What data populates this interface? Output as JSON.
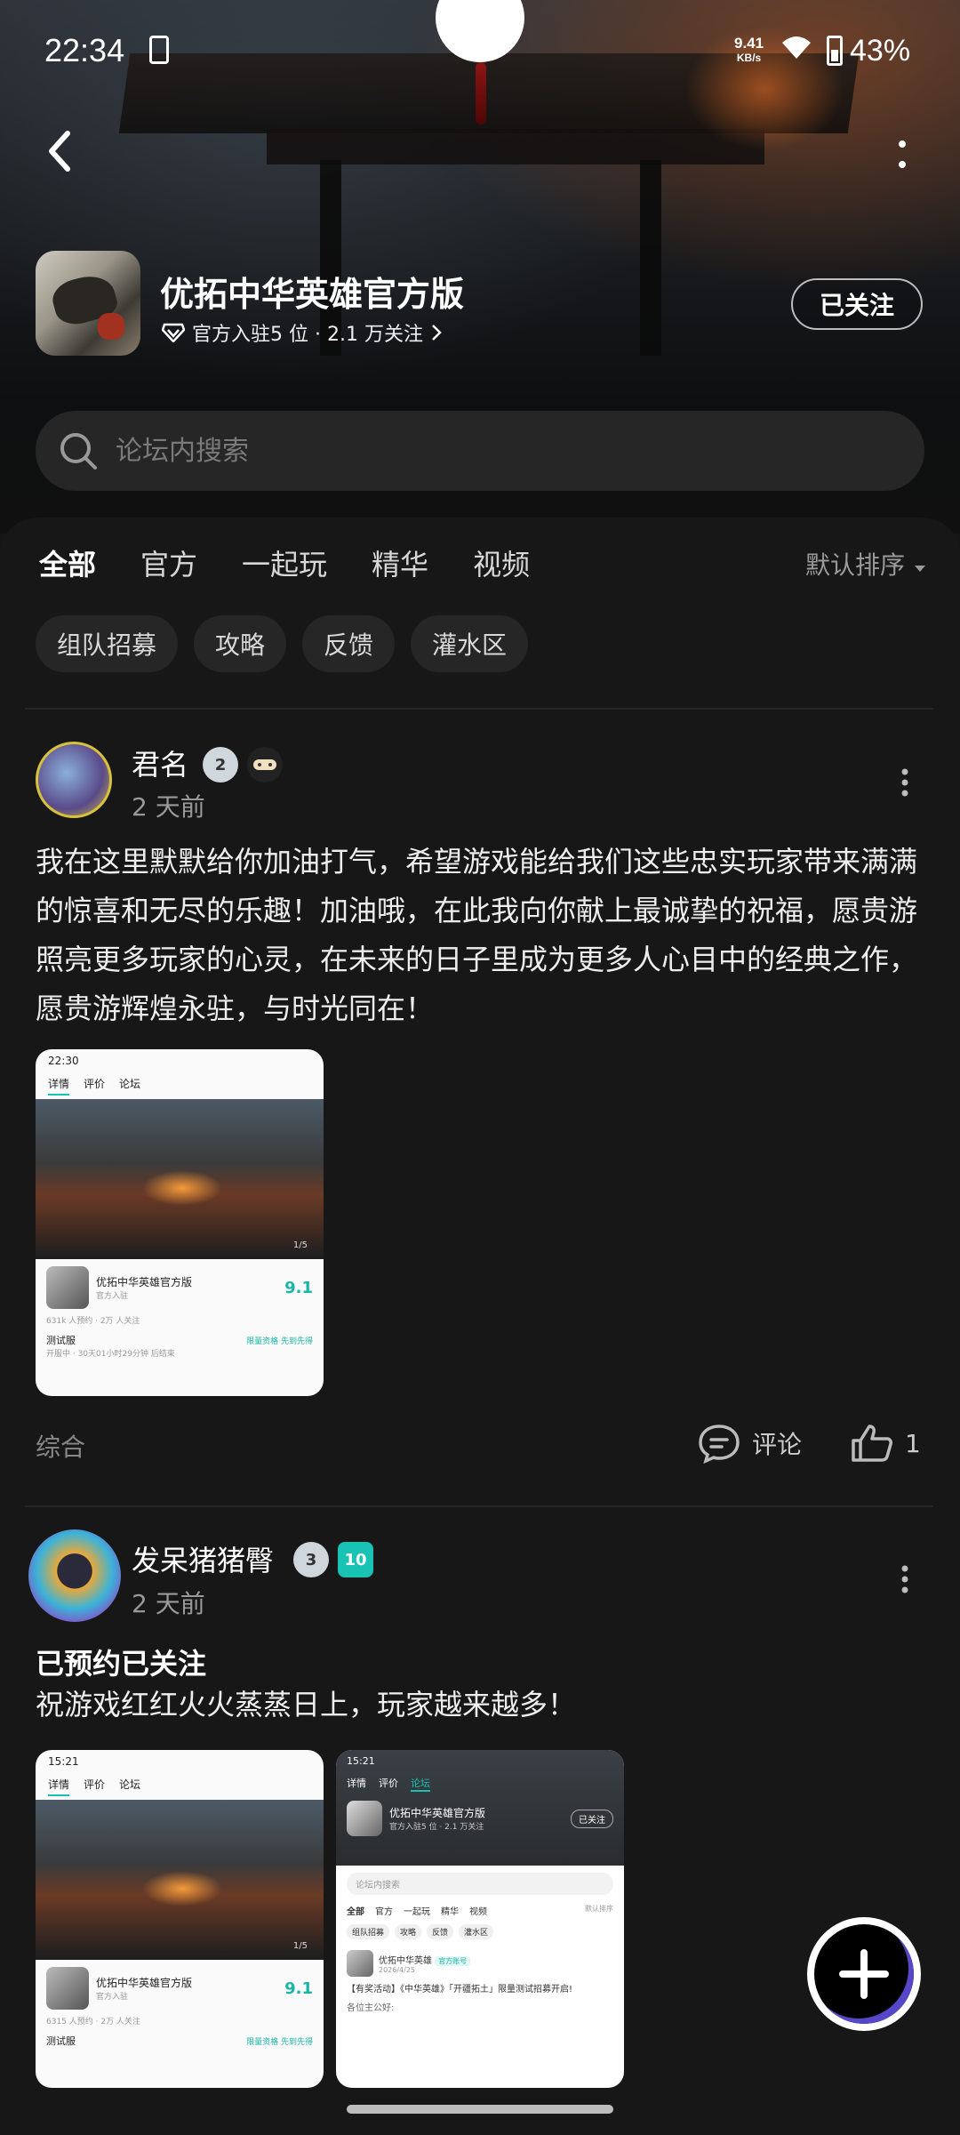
{
  "status": {
    "time": "22:34",
    "net_speed": "9.41",
    "net_unit": "KB/s",
    "battery": "43%"
  },
  "header": {
    "game_title": "优拓中华英雄官方版",
    "meta": "官方入驻5 位 · 2.1 万关注",
    "follow_label": "已关注"
  },
  "search": {
    "placeholder": "论坛内搜索"
  },
  "tabs": [
    "全部",
    "官方",
    "一起玩",
    "精华",
    "视频"
  ],
  "sort_label": "默认排序",
  "chips": [
    "组队招募",
    "攻略",
    "反馈",
    "灌水区"
  ],
  "posts": [
    {
      "user": "君名",
      "level": "2",
      "time": "2 天前",
      "text": "我在这里默默给你加油打气，希望游戏能给我们这些忠实玩家带来满满的惊喜和无尽的乐趣！加油哦，在此我向你献上最诚挚的祝福，愿贵游照亮更多玩家的心灵，在未来的日子里成为更多人心目中的经典之作，愿贵游辉煌永驻，与时光同在！",
      "category": "综合",
      "comment_label": "评论",
      "likes": "1",
      "shot": {
        "time": "22:30",
        "tabs": [
          "详情",
          "评价",
          "论坛"
        ],
        "game": "优拓中华英雄官方版",
        "sub": "官方入驻",
        "score": "9.1",
        "stats": "631k 人预约 · 2万 人关注",
        "server": "测试服",
        "server_info": "开服中 · 30天01小时29分钟 后结束",
        "counter": "1/5",
        "cta": "限量资格 先到先得"
      }
    },
    {
      "user": "发呆猪猪臀",
      "level": "3",
      "level2": "10",
      "time": "2 天前",
      "title": "已预约已关注",
      "text": "祝游戏红红火火蒸蒸日上，玩家越来越多！",
      "shot1": {
        "time": "15:21",
        "tabs": [
          "详情",
          "评价",
          "论坛"
        ],
        "game": "优拓中华英雄官方版",
        "sub": "官方入驻",
        "score": "9.1",
        "stats": "6315 人预约 · 2万 人关注",
        "server": "测试服",
        "counter": "1/5",
        "cta": "限量资格 先到先得"
      },
      "shot2": {
        "time": "15:21",
        "tabs": [
          "详情",
          "评价",
          "论坛"
        ],
        "game": "优拓中华英雄官方版",
        "meta": "官方入驻5 位 · 2.1 万关注",
        "follow": "已关注",
        "search": "论坛内搜索",
        "tabs2": [
          "全部",
          "官方",
          "一起玩",
          "精华",
          "视频"
        ],
        "sort": "默认排序",
        "chips": [
          "组队招募",
          "攻略",
          "反馈",
          "灌水区"
        ],
        "post_author": "优拓中华英雄",
        "post_badge": "官方账号",
        "post_date": "2026/4/25",
        "post_title": "【有奖活动】《中华英雄》「开疆拓土」限量测试招募开启!",
        "post_greet": "各位主公好:"
      }
    }
  ]
}
